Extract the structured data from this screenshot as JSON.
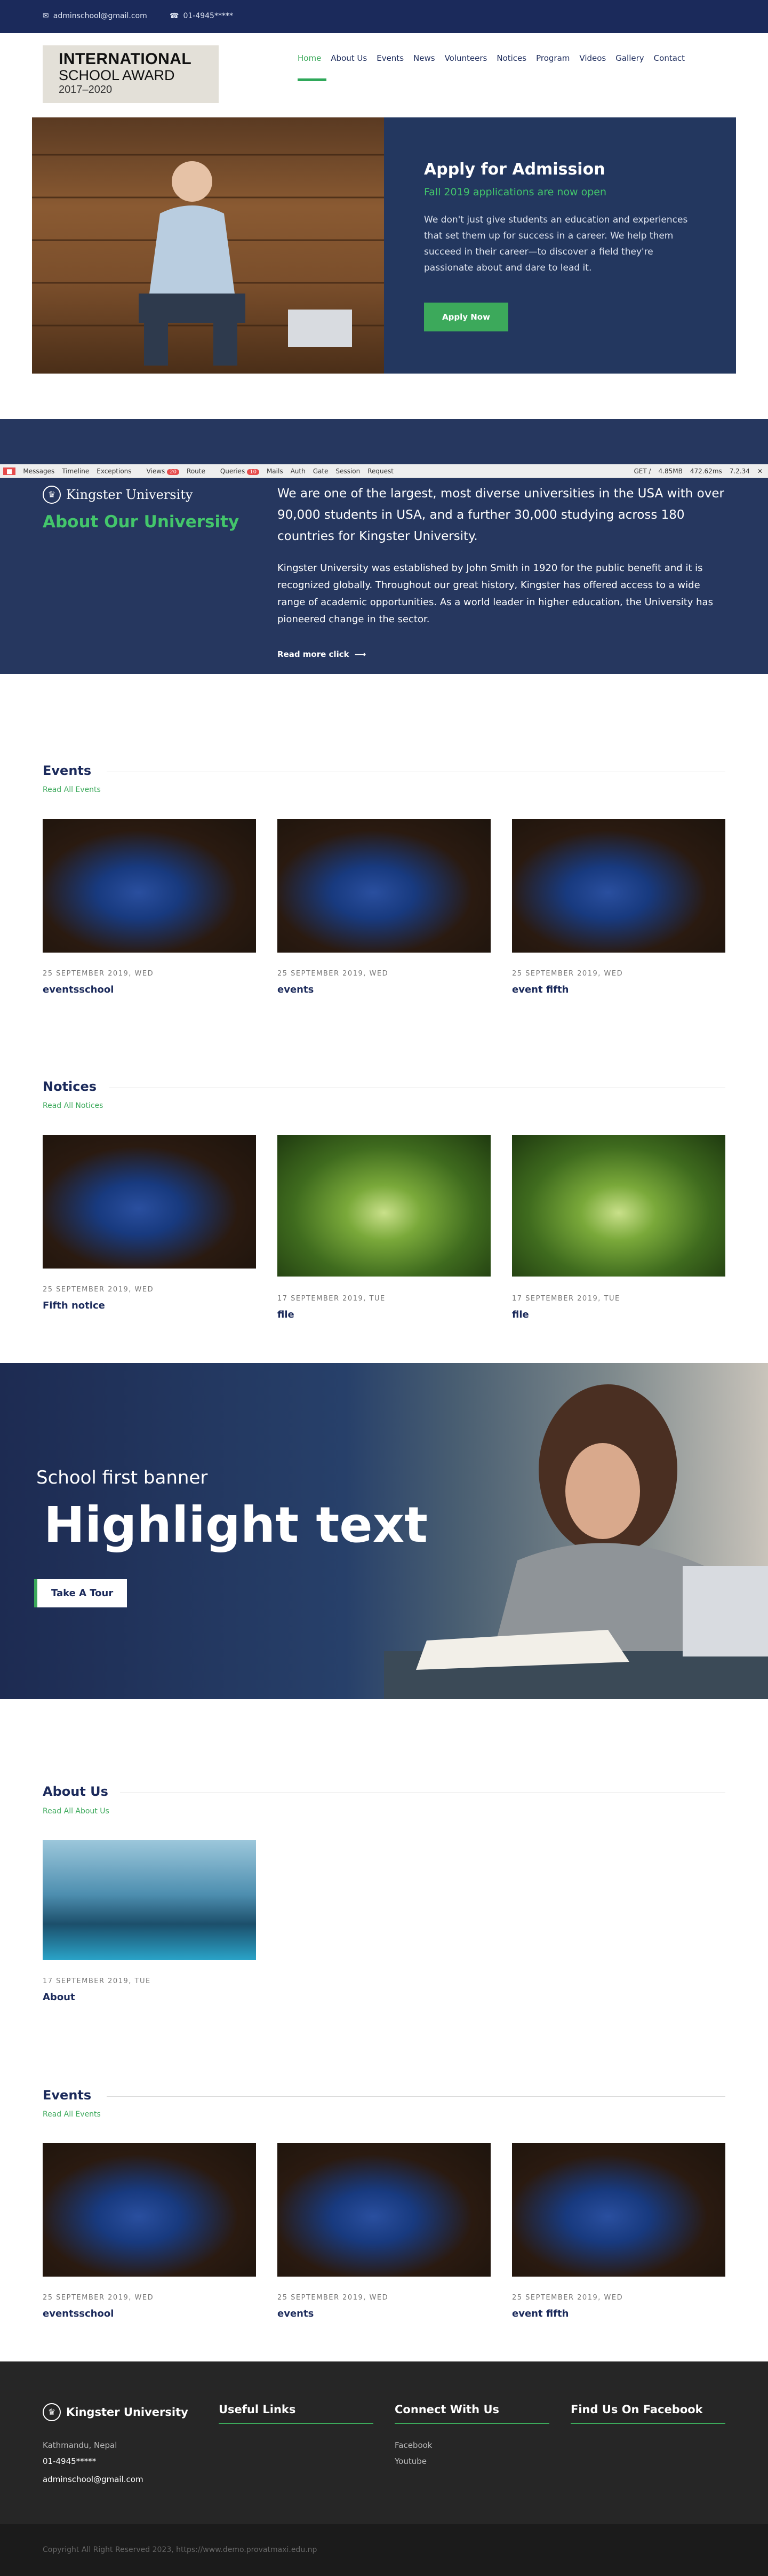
{
  "topbar": {
    "email": "adminschool@gmail.com",
    "phone": "01-4945*****"
  },
  "logo": {
    "line1": "INTERNATIONAL",
    "line2": "SCHOOL AWARD",
    "line3": "2017–2020"
  },
  "nav": [
    "Home",
    "About Us",
    "Events",
    "News",
    "Volunteers",
    "Notices",
    "Program",
    "Videos",
    "Gallery",
    "Contact"
  ],
  "admission": {
    "title": "Apply for Admission",
    "subtitle": "Fall 2019 applications are now open",
    "body": "We don't just give students an education and experiences that set them up for success in a career. We help them succeed in their career—to discover a field they're passionate about and dare to lead it.",
    "button": "Apply Now"
  },
  "debugbar": {
    "items": [
      "Messages",
      "Timeline",
      "Exceptions",
      "Views",
      "Route",
      "Queries",
      "Mails",
      "Auth",
      "Gate",
      "Session",
      "Request"
    ],
    "views_badge": "20",
    "queries_badge": "10",
    "right": [
      "GET /",
      "4.85MB",
      "472.62ms",
      "7.2.34"
    ]
  },
  "about": {
    "brand": "Kingster University",
    "heading": "About Our University",
    "lead": "We are one of the largest, most diverse universities in the USA with over 90,000 students in USA, and a further 30,000 studying across 180 countries for Kingster University.",
    "body": "Kingster University was established by John Smith in 1920 for the public benefit and it is recognized globally. Throughout our great history, Kingster has offered access to a wide range of academic opportunities. As a world leader in higher education, the University has pioneered change in the sector.",
    "more": "Read more click"
  },
  "events": {
    "title": "Events",
    "link": "Read All Events",
    "items": [
      {
        "date": "25 SEPTEMBER 2019, WED",
        "name": "eventsschool"
      },
      {
        "date": "25 SEPTEMBER 2019, WED",
        "name": "events"
      },
      {
        "date": "25 SEPTEMBER 2019, WED",
        "name": "event fifth"
      }
    ]
  },
  "notices": {
    "title": "Notices",
    "link": "Read All Notices",
    "items": [
      {
        "date": "25 SEPTEMBER 2019, WED",
        "name": "Fifth notice"
      },
      {
        "date": "17 SEPTEMBER 2019, TUE",
        "name": "file"
      },
      {
        "date": "17 SEPTEMBER 2019, TUE",
        "name": "file"
      }
    ]
  },
  "banner": {
    "small": "School first banner",
    "big": "Highlight text",
    "button": "Take A Tour"
  },
  "aboutus": {
    "title": "About Us",
    "link": "Read All About Us",
    "items": [
      {
        "date": "17 SEPTEMBER 2019, TUE",
        "name": "About"
      }
    ]
  },
  "events2": {
    "title": "Events",
    "link": "Read All Events",
    "items": [
      {
        "date": "25 SEPTEMBER 2019, WED",
        "name": "eventsschool"
      },
      {
        "date": "25 SEPTEMBER 2019, WED",
        "name": "events"
      },
      {
        "date": "25 SEPTEMBER 2019, WED",
        "name": "event fifth"
      }
    ]
  },
  "footer": {
    "brand": "Kingster University",
    "address": "Kathmandu, Nepal",
    "phone": "01-4945*****",
    "email": "adminschool@gmail.com",
    "useful": "Useful Links",
    "connect": "Connect With Us",
    "facebook_title": "Find Us On Facebook",
    "social": [
      "Facebook",
      "Youtube"
    ]
  },
  "copyright": "Copyright All Right Reserved 2023, https://www.demo.provatmaxi.edu.np",
  "colors": {
    "navy": "#1b2a5b",
    "green": "#3ca95b"
  }
}
